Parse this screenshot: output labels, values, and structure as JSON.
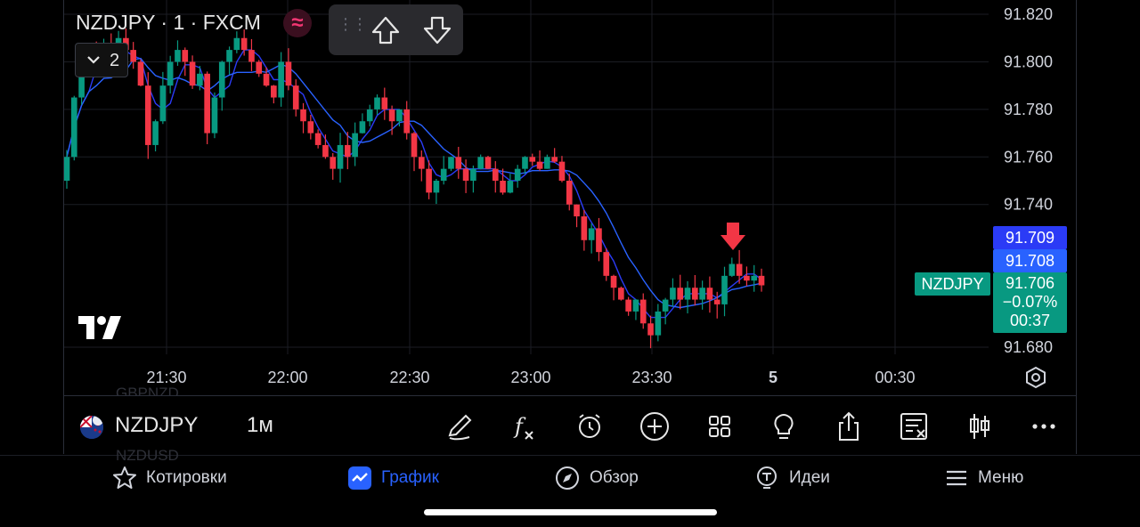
{
  "header": {
    "symbol_title": "NZDJPY · 1 · FXCM",
    "indicator_badge": "≈",
    "collapse_count": "2"
  },
  "price_axis": {
    "labels": [
      "91.820",
      "91.800",
      "91.780",
      "91.760",
      "91.740",
      "91.680"
    ]
  },
  "time_axis": {
    "labels": [
      "21:30",
      "22:00",
      "22:30",
      "23:00",
      "23:30",
      "5",
      "00:30"
    ]
  },
  "price_tags": {
    "ma_fast": "91.709",
    "ma_slow": "91.708",
    "last_price": "91.706",
    "change": "−0.07%",
    "countdown": "00:37",
    "symbol": "NZDJPY"
  },
  "toolbar": {
    "symbol": "NZDJPY",
    "interval": "1м",
    "ghost_text_1": "GBPNZD",
    "ghost_text_2": "NZDUSD"
  },
  "nav": {
    "quotes": "Котировки",
    "chart": "График",
    "overview": "Обзор",
    "ideas": "Идеи",
    "menu": "Меню"
  },
  "colors": {
    "up": "#089981",
    "down": "#f23645",
    "ma_fast": "#2b3bf6",
    "ma_slow": "#2962ff",
    "accent": "#2962ff"
  },
  "chart_data": {
    "type": "candlestick",
    "symbol": "NZDJPY",
    "interval": "1",
    "source": "FXCM",
    "ylim": [
      91.677,
      91.826
    ],
    "y_ticks": [
      91.68,
      91.74,
      91.76,
      91.78,
      91.8,
      91.82
    ],
    "x_ticks": [
      "21:30",
      "22:00",
      "22:30",
      "23:00",
      "23:30",
      "5",
      "00:30"
    ],
    "last_price": 91.706,
    "change_pct": -0.07,
    "close_series": [
      91.76,
      91.785,
      91.8,
      91.805,
      91.8,
      91.808,
      91.795,
      91.81,
      91.805,
      91.8,
      91.79,
      91.765,
      91.775,
      91.79,
      91.8,
      91.805,
      91.8,
      91.79,
      91.795,
      91.77,
      91.785,
      91.8,
      91.805,
      91.81,
      91.805,
      91.8,
      91.795,
      91.79,
      91.785,
      91.8,
      91.79,
      91.78,
      91.775,
      91.77,
      91.765,
      91.76,
      91.755,
      91.765,
      91.76,
      91.77,
      91.775,
      91.78,
      91.785,
      91.78,
      91.775,
      91.78,
      91.77,
      91.76,
      91.755,
      91.745,
      91.75,
      91.755,
      91.76,
      91.755,
      91.75,
      91.755,
      91.76,
      91.755,
      91.75,
      91.745,
      91.75,
      91.755,
      91.76,
      91.758,
      91.755,
      91.76,
      91.758,
      91.75,
      91.74,
      91.735,
      91.725,
      91.73,
      91.72,
      91.71,
      91.705,
      91.7,
      91.695,
      91.7,
      91.69,
      91.685,
      91.695,
      91.7,
      91.705,
      91.7,
      91.705,
      91.7,
      91.705,
      91.7,
      91.698,
      91.71,
      91.715,
      91.71,
      91.708,
      91.71,
      91.706
    ]
  }
}
